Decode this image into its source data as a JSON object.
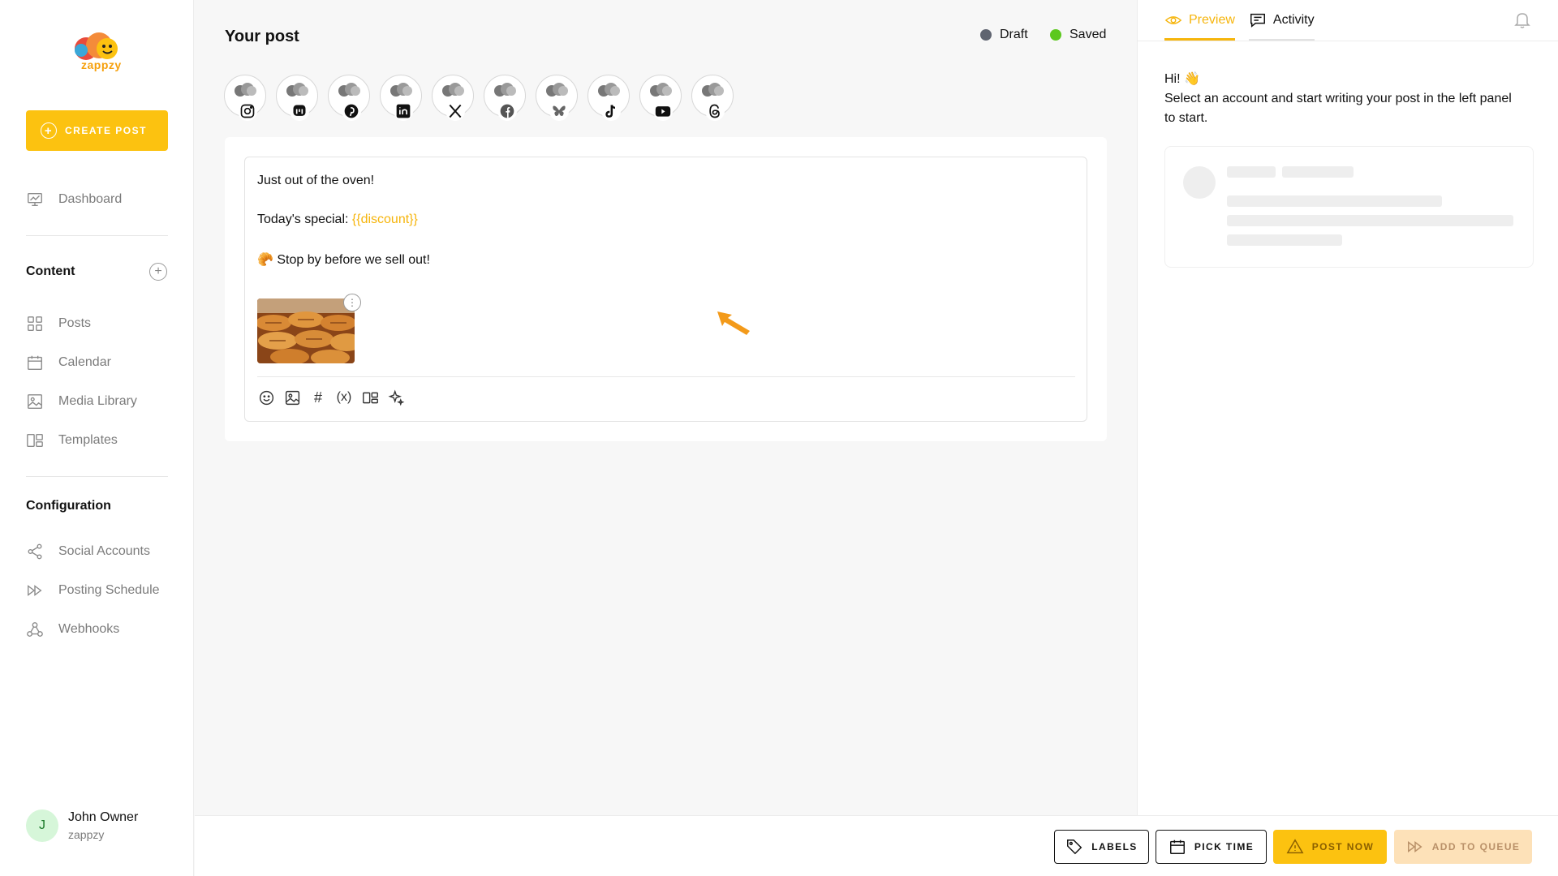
{
  "brand": {
    "name": "zappzy",
    "accent": "#fcc210",
    "variable_color": "#f6b50c"
  },
  "sidebar": {
    "create_label": "CREATE POST",
    "dashboard_label": "Dashboard",
    "content_title": "Content",
    "content_items": [
      {
        "label": "Posts",
        "icon": "grid-icon"
      },
      {
        "label": "Calendar",
        "icon": "calendar-icon"
      },
      {
        "label": "Media Library",
        "icon": "image-icon"
      },
      {
        "label": "Templates",
        "icon": "templates-icon"
      }
    ],
    "config_title": "Configuration",
    "config_items": [
      {
        "label": "Social Accounts",
        "icon": "share-icon"
      },
      {
        "label": "Posting Schedule",
        "icon": "fast-forward-icon"
      },
      {
        "label": "Webhooks",
        "icon": "webhook-icon"
      }
    ],
    "user": {
      "initial": "J",
      "name": "John Owner",
      "org": "zappzy"
    }
  },
  "editor": {
    "title": "Your post",
    "status_draft": "Draft",
    "status_saved": "Saved",
    "status_colors": {
      "draft": "#5f6470",
      "saved": "#5cc81e"
    },
    "accounts": [
      "instagram",
      "mastodon",
      "pinterest",
      "linkedin",
      "x",
      "facebook",
      "bluesky",
      "tiktok",
      "youtube",
      "threads"
    ],
    "line1": "Just out of the oven!",
    "line2_prefix": "Today's special: ",
    "line2_variable": "{{discount}}",
    "line3_emoji": "🥐",
    "line3_text": "Stop by before we sell out!",
    "tools": [
      "emoji-icon",
      "image-icon",
      "hashtag-icon",
      "variable-icon",
      "templates-icon",
      "ai-sparkle-icon"
    ],
    "variable_tool_label": "(x)",
    "hashtag_tool_label": "#"
  },
  "preview": {
    "tab_preview": "Preview",
    "tab_activity": "Activity",
    "greeting": "Hi! 👋",
    "message": "Select an account and start writing your post in the left panel to start."
  },
  "actions": {
    "labels": "LABELS",
    "pick_time": "PICK TIME",
    "post_now": "POST NOW",
    "add_to_queue": "ADD TO QUEUE"
  }
}
